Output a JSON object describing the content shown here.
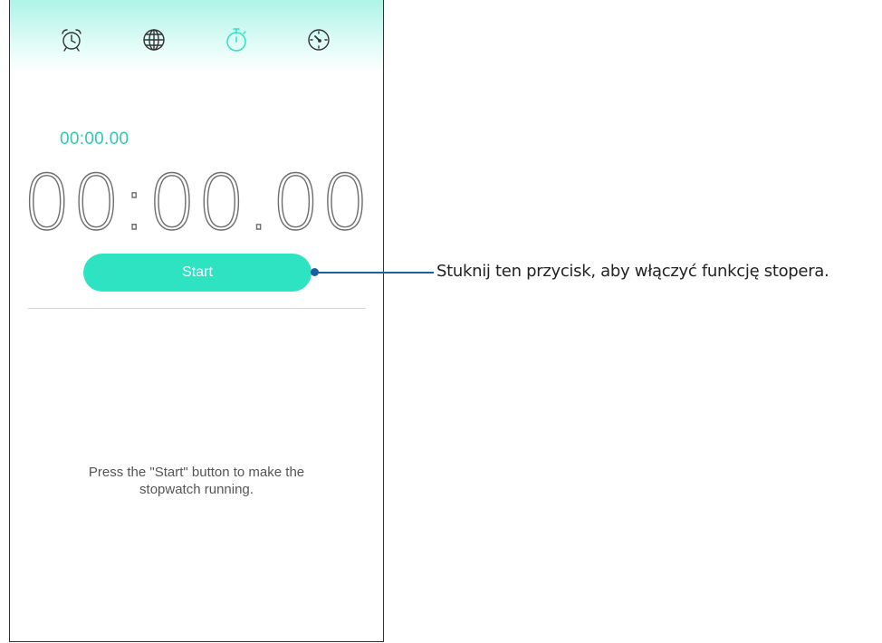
{
  "tabs": [
    {
      "icon": "alarm-clock-icon",
      "active": false
    },
    {
      "icon": "globe-icon",
      "active": false
    },
    {
      "icon": "stopwatch-icon",
      "active": true
    },
    {
      "icon": "timer-icon",
      "active": false
    }
  ],
  "colors": {
    "accent": "#2ee3c1",
    "lap_text": "#2fc9b1",
    "inactive_icon": "#333333",
    "active_icon": "#2ee3c1",
    "callout": "#1d5fa3",
    "tabbar_top": "#aef3e7"
  },
  "stopwatch": {
    "lap_time": "00:00.00",
    "main_time": "00:00.00",
    "start_label": "Start",
    "hint": "Press the \"Start\" button to make the\nstopwatch running."
  },
  "callout": {
    "text": "Stuknij ten przycisk, aby włączyć funkcję stopera."
  }
}
